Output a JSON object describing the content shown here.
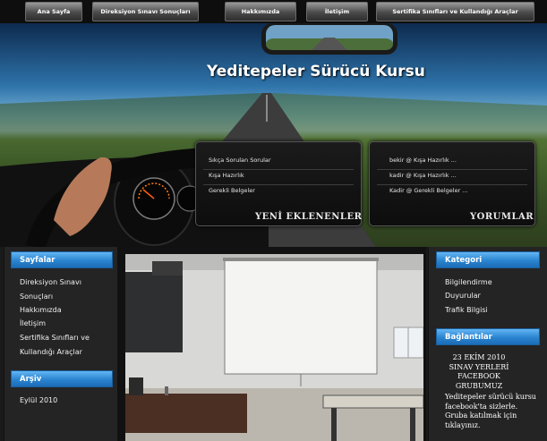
{
  "nav": [
    "Ana Sayfa",
    "Direksiyon Sınavı Sonuçları",
    "Hakkımızda",
    "İletişim",
    "Sertifika Sınıfları ve Kullandığı Araçlar"
  ],
  "hero": {
    "title": "Yeditepeler Sürücü Kursu",
    "new_items": {
      "heading": "YENİ EKLENENLER",
      "links": [
        "Sıkça Sorulan Sorular",
        "Kışa Hazırlık",
        "Gerekli Belgeler"
      ]
    },
    "comments": {
      "heading": "YORUMLAR",
      "links": [
        "bekir @ Kışa Hazırlık ...",
        "kadir @ Kışa Hazırlık ...",
        "Kadir @ Gerekli Belgeler ..."
      ]
    }
  },
  "left_sidebar": {
    "pages_heading": "Sayfalar",
    "pages": [
      "Direksiyon Sınavı Sonuçları",
      "Hakkımızda",
      "İletişim",
      "Sertifika Sınıfları ve Kullandığı Araçlar"
    ],
    "archive_heading": "Arşiv",
    "archive": [
      "Eylül 2010"
    ]
  },
  "right_sidebar": {
    "category_heading": "Kategori",
    "categories": [
      "Bilgilendirme",
      "Duyurular",
      "Trafik Bilgisi"
    ],
    "links_heading": "Bağlantılar",
    "links_text": "23 EKİM 2010 SINAV YERLERİ FACEBOOK GRUBUMUZ",
    "links_body": "Yeditepeler sürücü kursu facebook'ta sizlerle. Gruba katılmak için tıklayınız."
  }
}
